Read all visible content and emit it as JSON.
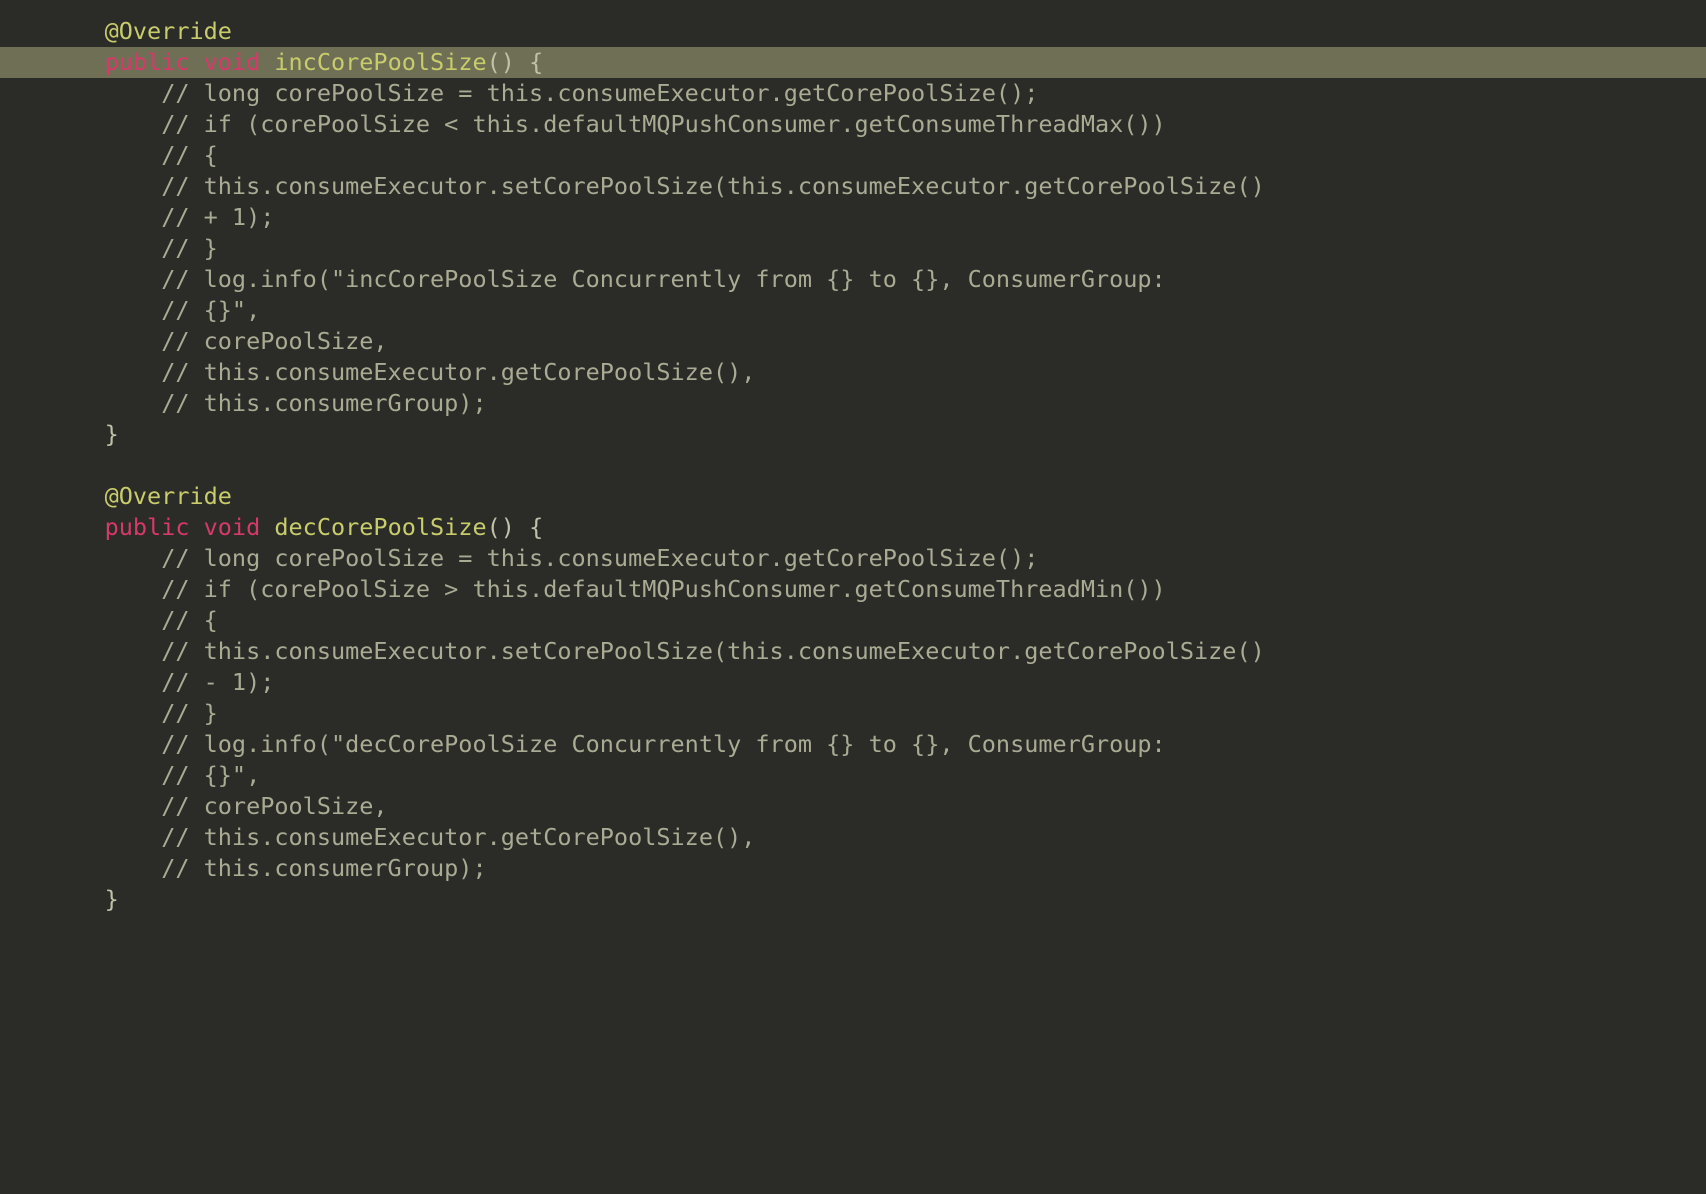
{
  "code": {
    "lines": [
      {
        "indent": 1,
        "hl": false,
        "segs": [
          {
            "cls": "annotation",
            "t": "@Override"
          }
        ]
      },
      {
        "indent": 1,
        "hl": true,
        "segs": [
          {
            "cls": "keyword",
            "t": "public"
          },
          {
            "cls": "plain",
            "t": " "
          },
          {
            "cls": "typekw",
            "t": "void"
          },
          {
            "cls": "plain",
            "t": " "
          },
          {
            "cls": "method",
            "t": "incCorePoolSize"
          },
          {
            "cls": "paren",
            "t": "()"
          },
          {
            "cls": "plain",
            "t": " "
          },
          {
            "cls": "brace",
            "t": "{"
          }
        ]
      },
      {
        "indent": 2,
        "hl": false,
        "segs": [
          {
            "cls": "comment",
            "t": "// long corePoolSize = this.consumeExecutor.getCorePoolSize();"
          }
        ]
      },
      {
        "indent": 2,
        "hl": false,
        "segs": [
          {
            "cls": "comment",
            "t": "// if (corePoolSize < this.defaultMQPushConsumer.getConsumeThreadMax())"
          }
        ]
      },
      {
        "indent": 2,
        "hl": false,
        "segs": [
          {
            "cls": "comment",
            "t": "// {"
          }
        ]
      },
      {
        "indent": 2,
        "hl": false,
        "segs": [
          {
            "cls": "comment",
            "t": "// this.consumeExecutor.setCorePoolSize(this.consumeExecutor.getCorePoolSize()"
          }
        ]
      },
      {
        "indent": 2,
        "hl": false,
        "segs": [
          {
            "cls": "comment",
            "t": "// + 1);"
          }
        ]
      },
      {
        "indent": 2,
        "hl": false,
        "segs": [
          {
            "cls": "comment",
            "t": "// }"
          }
        ]
      },
      {
        "indent": 2,
        "hl": false,
        "segs": [
          {
            "cls": "comment",
            "t": "// log.info(\"incCorePoolSize Concurrently from {} to {}, ConsumerGroup:"
          }
        ]
      },
      {
        "indent": 2,
        "hl": false,
        "segs": [
          {
            "cls": "comment",
            "t": "// {}\","
          }
        ]
      },
      {
        "indent": 2,
        "hl": false,
        "segs": [
          {
            "cls": "comment",
            "t": "// corePoolSize,"
          }
        ]
      },
      {
        "indent": 2,
        "hl": false,
        "segs": [
          {
            "cls": "comment",
            "t": "// this.consumeExecutor.getCorePoolSize(),"
          }
        ]
      },
      {
        "indent": 2,
        "hl": false,
        "segs": [
          {
            "cls": "comment",
            "t": "// this.consumerGroup);"
          }
        ]
      },
      {
        "indent": 1,
        "hl": false,
        "segs": [
          {
            "cls": "brace",
            "t": "}"
          }
        ]
      },
      {
        "indent": 0,
        "hl": false,
        "segs": []
      },
      {
        "indent": 1,
        "hl": false,
        "segs": [
          {
            "cls": "annotation",
            "t": "@Override"
          }
        ]
      },
      {
        "indent": 1,
        "hl": false,
        "segs": [
          {
            "cls": "keyword",
            "t": "public"
          },
          {
            "cls": "plain",
            "t": " "
          },
          {
            "cls": "typekw",
            "t": "void"
          },
          {
            "cls": "plain",
            "t": " "
          },
          {
            "cls": "method",
            "tz": "decCorePoolSize"
          },
          {
            "cls": "paren",
            "t": "()"
          },
          {
            "cls": "plain",
            "t": " "
          },
          {
            "cls": "brace",
            "t": "{"
          }
        ]
      },
      {
        "indent": 2,
        "hl": false,
        "segs": [
          {
            "cls": "comment",
            "t": "// long corePoolSize = this.consumeExecutor.getCorePoolSize();"
          }
        ]
      },
      {
        "indent": 2,
        "hl": false,
        "segs": [
          {
            "cls": "comment",
            "t": "// if (corePoolSize > this.defaultMQPushConsumer.getConsumeThreadMin())"
          }
        ]
      },
      {
        "indent": 2,
        "hl": false,
        "segs": [
          {
            "cls": "comment",
            "t": "// {"
          }
        ]
      },
      {
        "indent": 2,
        "hl": false,
        "segs": [
          {
            "cls": "comment",
            "t": "// this.consumeExecutor.setCorePoolSize(this.consumeExecutor.getCorePoolSize()"
          }
        ]
      },
      {
        "indent": 2,
        "hl": false,
        "segs": [
          {
            "cls": "comment",
            "t": "// - 1);"
          }
        ]
      },
      {
        "indent": 2,
        "hl": false,
        "segs": [
          {
            "cls": "comment",
            "t": "// }"
          }
        ]
      },
      {
        "indent": 2,
        "hl": false,
        "segs": [
          {
            "cls": "comment",
            "t": "// log.info(\"decCorePoolSize Concurrently from {} to {}, ConsumerGroup:"
          }
        ]
      },
      {
        "indent": 2,
        "hl": false,
        "segs": [
          {
            "cls": "comment",
            "t": "// {}\","
          }
        ]
      },
      {
        "indent": 2,
        "hl": false,
        "segs": [
          {
            "cls": "comment",
            "t": "// corePoolSize,"
          }
        ]
      },
      {
        "indent": 2,
        "hl": false,
        "segs": [
          {
            "cls": "comment",
            "t": "// this.consumeExecutor.getCorePoolSize(),"
          }
        ]
      },
      {
        "indent": 2,
        "hl": false,
        "segs": [
          {
            "cls": "comment",
            "t": "// this.consumerGroup);"
          }
        ]
      },
      {
        "indent": 1,
        "hl": false,
        "segs": [
          {
            "cls": "brace",
            "t": "}"
          }
        ]
      }
    ]
  },
  "gutter": {
    "intention_hint": "intention-bulb"
  },
  "colors": {
    "bg": "#2b2b28",
    "highlight": "#6f6f55",
    "annotation": "#c8cc6b",
    "keyword": "#d6396a",
    "method": "#c8cc6b",
    "comment": "#a9ab93",
    "text": "#bfc1a8"
  }
}
